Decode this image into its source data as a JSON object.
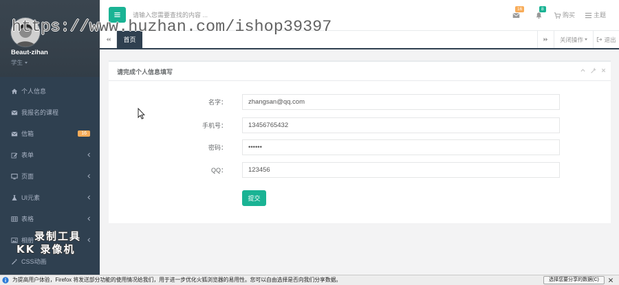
{
  "watermark": {
    "url_text": "https://www.huzhan.com/ishop39397",
    "recorder_line1": "录制工具",
    "recorder_line2": "KK 录像机"
  },
  "colors": {
    "sidebar_bg": "#2f4050",
    "sidebar_text": "#a7b1c2",
    "accent_green": "#1ab394",
    "badge_orange": "#f8ac59",
    "content_bg": "#f3f3f4"
  },
  "sidebar": {
    "user": {
      "name": "Beaut-zihan",
      "role": "学生"
    },
    "items": [
      {
        "label": "个人信息",
        "icon": "home-icon"
      },
      {
        "label": "我报名的课程",
        "icon": "envelope-icon"
      },
      {
        "label": "信箱",
        "icon": "envelope-icon",
        "badge": "16"
      },
      {
        "label": "表单",
        "icon": "edit-icon",
        "submenu": true
      },
      {
        "label": "页面",
        "icon": "desktop-icon",
        "submenu": true
      },
      {
        "label": "UI元素",
        "icon": "flask-icon",
        "submenu": true
      },
      {
        "label": "表格",
        "icon": "table-icon",
        "submenu": true
      },
      {
        "label": "相册",
        "icon": "picture-icon",
        "submenu": true
      },
      {
        "label": "CSS动画",
        "icon": "magic-icon"
      }
    ]
  },
  "topbar": {
    "search_placeholder": "请输入您需要查找的内容 ...",
    "mail_badge": "16",
    "bell_badge": "8",
    "buy_label": "购买",
    "theme_label": "主题"
  },
  "tabs": {
    "items": [
      {
        "label": "首页",
        "active": true
      }
    ],
    "close_ops_label": "关闭操作",
    "logout_label": "退出"
  },
  "panel": {
    "title": "请完成个人信息填写"
  },
  "form": {
    "fields": [
      {
        "label": "名字：",
        "value": "zhangsan@qq.com"
      },
      {
        "label": "手机号：",
        "value": "13456765432"
      },
      {
        "label": "密码：",
        "value": "••••••"
      },
      {
        "label": "QQ：",
        "value": "123456"
      }
    ],
    "submit_label": "提交"
  },
  "notification": {
    "message": "为提高用户体验，Firefox 将发送部分功能的使用情况给我们，用于进一步优化火狐浏览器的易用性。您可以自由选择是否向我们分享数据。",
    "button_label": "选择您要分享的数据(C)"
  }
}
